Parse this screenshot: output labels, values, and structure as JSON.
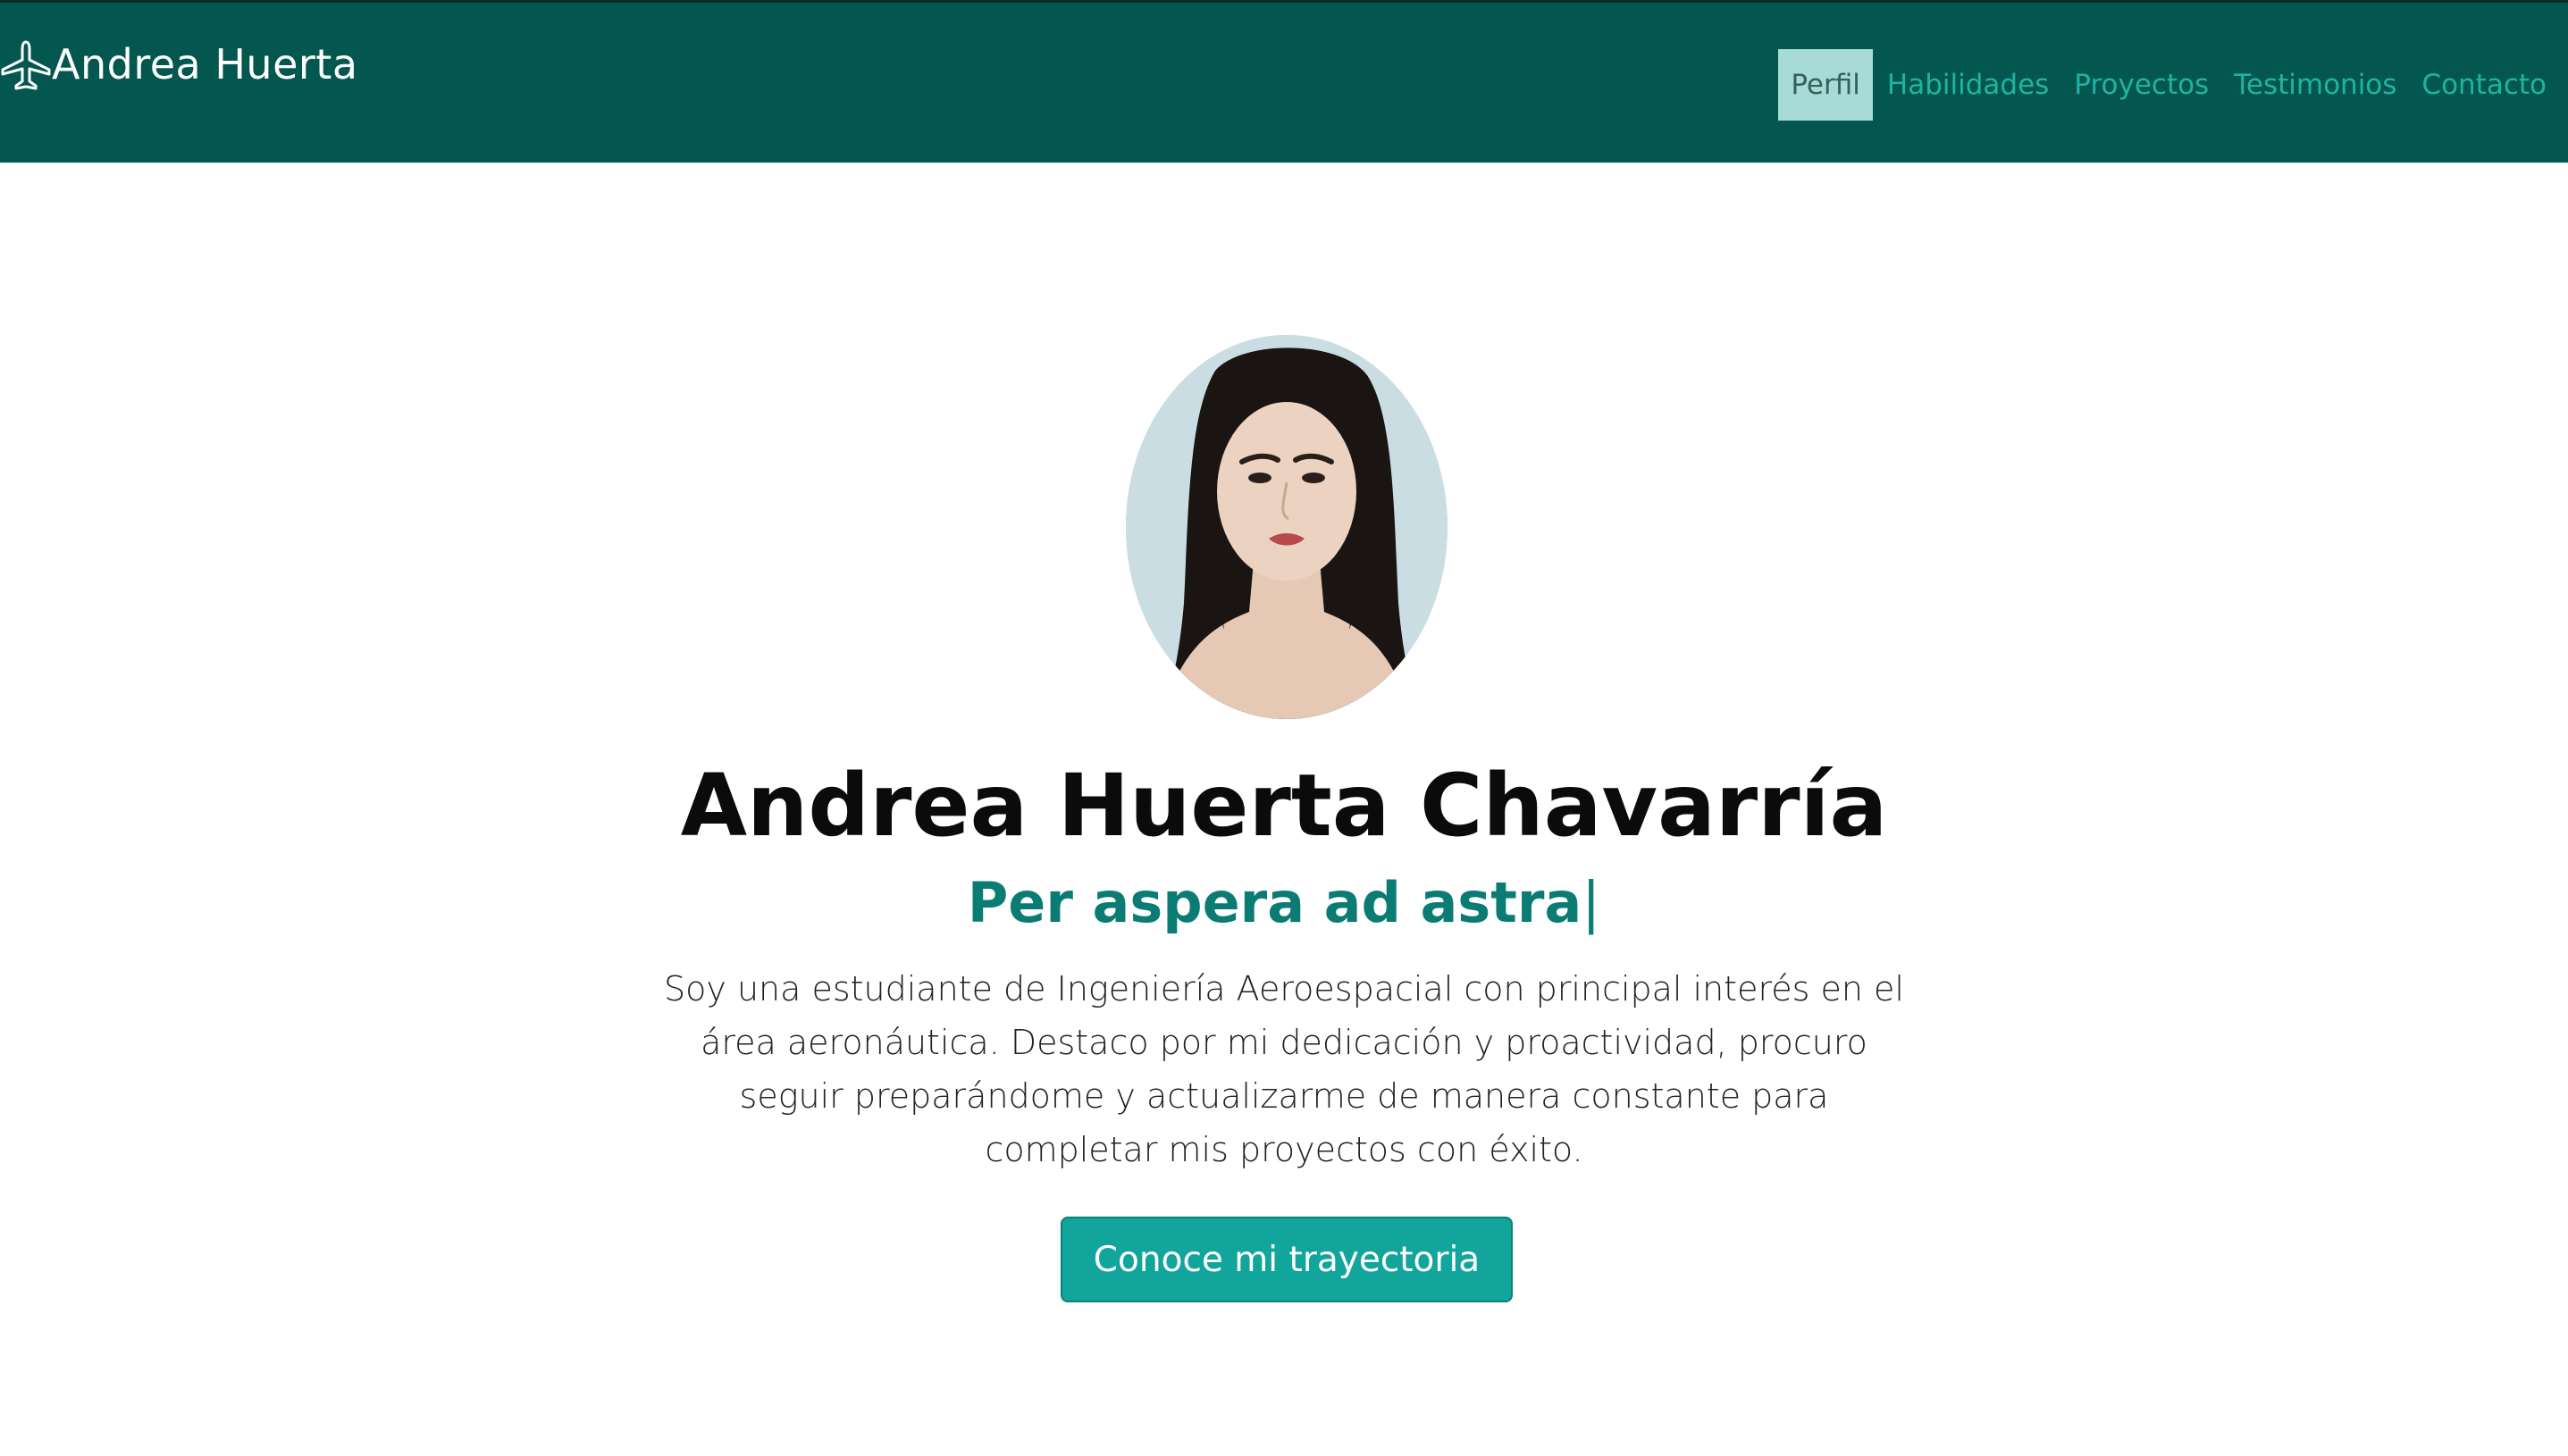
{
  "brand": {
    "name": "Andrea Huerta",
    "icon": "airplane-icon"
  },
  "nav": {
    "items": [
      {
        "label": "Perfil",
        "active": true
      },
      {
        "label": "Habilidades",
        "active": false
      },
      {
        "label": "Proyectos",
        "active": false
      },
      {
        "label": "Testimonios",
        "active": false
      },
      {
        "label": "Contacto",
        "active": false
      }
    ]
  },
  "hero": {
    "name": "Andrea Huerta Chavarría",
    "motto": "Per aspera ad astra",
    "cursor": "|",
    "bio": "Soy una estudiante de Ingeniería Aeroespacial con principal interés en el área aeronáutica. Destaco por mi dedicación y proactividad, procuro seguir preparándome y actualizarme de manera constante para completar mis proyectos con éxito.",
    "cta_label": "Conoce mi trayectoria"
  },
  "colors": {
    "navbar_bg": "#03574e",
    "nav_link": "#1fb3a6",
    "nav_active_bg": "#a6dbd7",
    "accent": "#0a7c73",
    "button_bg": "#12a59b"
  }
}
